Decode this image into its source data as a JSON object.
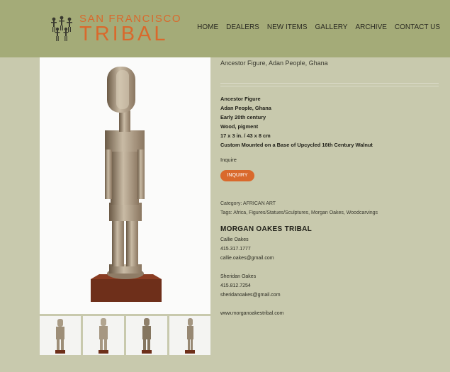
{
  "brand": {
    "line1": "SAN FRANCISCO",
    "line2": "TRIBAL",
    "accent_color": "#d9692c",
    "header_color": "#a4ab78",
    "page_color": "#c8c9ad"
  },
  "nav": {
    "items": [
      "HOME",
      "DEALERS",
      "NEW ITEMS",
      "GALLERY",
      "ARCHIVE",
      "CONTACT US"
    ]
  },
  "product": {
    "title": "Ancestor Figure, Adan People, Ghana",
    "details": [
      "Ancestor Figure",
      "Adan People, Ghana",
      "Early 20th century",
      "Wood, pigment",
      "17 x 3 in. / 43 x 8 cm",
      "Custom Mounted on a Base of Upcycled 16th Century Walnut"
    ],
    "inquire_text": "Inquire",
    "inquiry_button": "INQUIRY",
    "category_label": "Category:",
    "category": "AFRICAN ART",
    "tags_label": "Tags:",
    "tags": "Africa, Figures/Statues/Sculptures, Morgan Oakes, Woodcarvings"
  },
  "dealer": {
    "name": "MORGAN OAKES TRIBAL",
    "contacts": [
      {
        "name": "Callie Oakes",
        "phone": "415.317.1777",
        "email": "callie.oakes@gmail.com"
      },
      {
        "name": "Sheridan Oakes",
        "phone": "415.812.7254",
        "email": "sheridanoakes@gmail.com"
      }
    ],
    "website": "www.morganoakestribal.com"
  },
  "images": {
    "main_icon": "ancestor-figure-photo",
    "thumb_count": 4
  }
}
